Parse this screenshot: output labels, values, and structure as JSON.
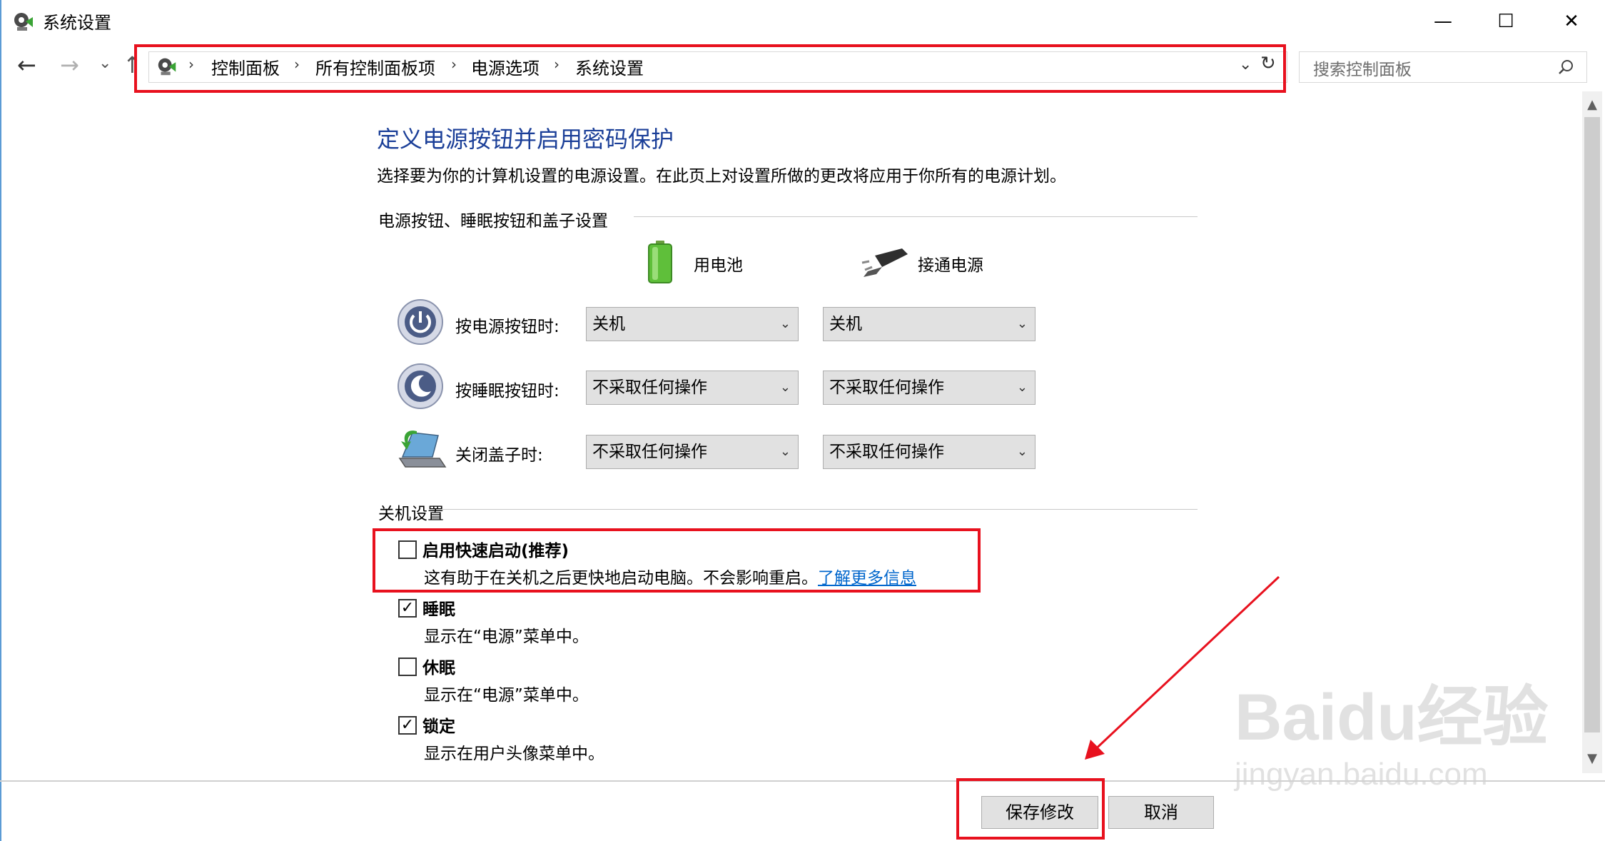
{
  "window": {
    "title": "系统设置",
    "minimize_glyph": "—",
    "maximize_glyph": "☐",
    "close_glyph": "✕"
  },
  "nav": {
    "back_glyph": "←",
    "forward_glyph": "→",
    "recent_glyph": "⌄",
    "up_glyph": "↑",
    "breadcrumb": [
      "控制面板",
      "所有控制面板项",
      "电源选项",
      "系统设置"
    ],
    "separator": "›",
    "dropdown_glyph": "⌄",
    "refresh_glyph": "↻",
    "search_placeholder": "搜索控制面板"
  },
  "main": {
    "heading": "定义电源按钮并启用密码保护",
    "description": "选择要为你的计算机设置的电源设置。在此页上对设置所做的更改将应用于你所有的电源计划。",
    "section1_title": "电源按钮、睡眠按钮和盖子设置",
    "col_battery": "用电池",
    "col_plugged": "接通电源",
    "rows": [
      {
        "label": "按电源按钮时:",
        "battery": "关机",
        "plugged": "关机",
        "icon": "power-button-icon"
      },
      {
        "label": "按睡眠按钮时:",
        "battery": "不采取任何操作",
        "plugged": "不采取任何操作",
        "icon": "sleep-button-icon"
      },
      {
        "label": "关闭盖子时:",
        "battery": "不采取任何操作",
        "plugged": "不采取任何操作",
        "icon": "laptop-lid-icon"
      }
    ],
    "section2_title": "关机设置",
    "shutdown": [
      {
        "label": "启用快速启动(推荐)",
        "desc": "这有助于在关机之后更快地启动电脑。不会影响重启。",
        "link": "了解更多信息",
        "checked": false
      },
      {
        "label": "睡眠",
        "desc": "显示在“电源”菜单中。",
        "checked": true
      },
      {
        "label": "休眠",
        "desc": "显示在“电源”菜单中。",
        "checked": false
      },
      {
        "label": "锁定",
        "desc": "显示在用户头像菜单中。",
        "checked": true
      }
    ]
  },
  "footer": {
    "save_label": "保存修改",
    "cancel_label": "取消"
  },
  "watermark": {
    "logo_text": "Baidu经验",
    "url_text": "jingyan.baidu.com"
  },
  "colors": {
    "heading": "#1b3f98",
    "highlight": "#e8111e",
    "link": "#0066cc"
  }
}
